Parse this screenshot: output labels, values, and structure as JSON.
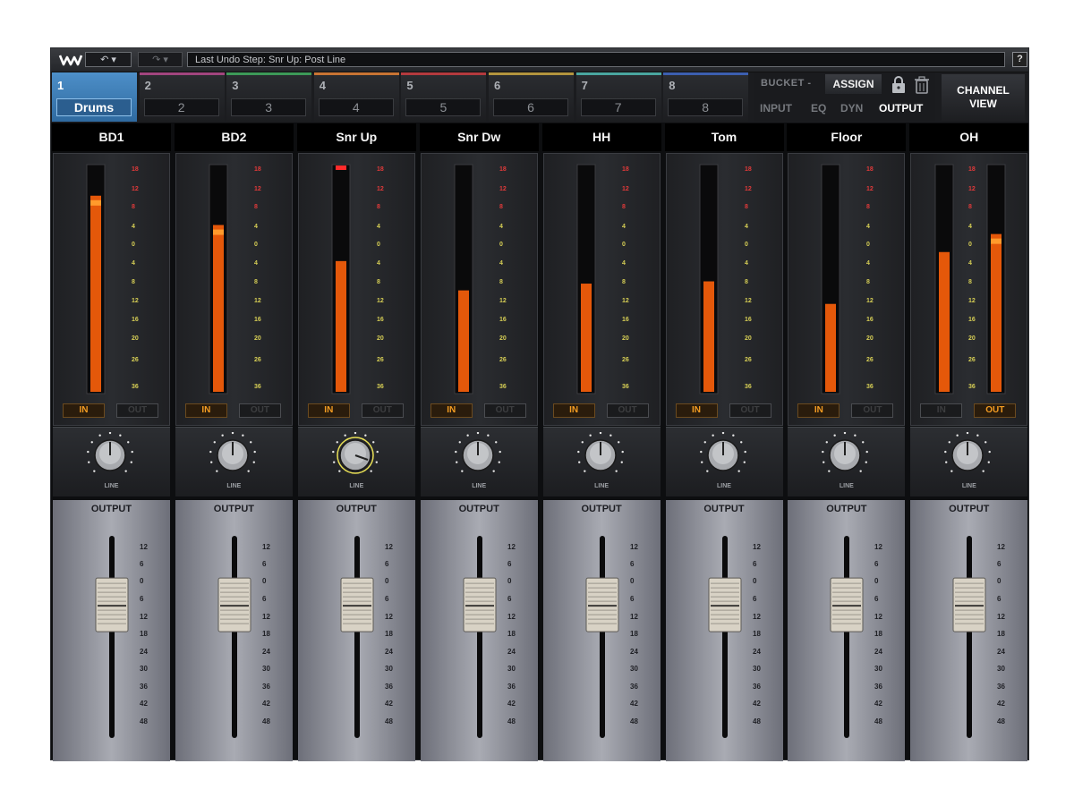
{
  "toolbar": {
    "logo": "waves-logo",
    "undo_label": "↶ ▾",
    "redo_label": "↷ ▾",
    "undo_step": "Last Undo Step:  Snr Up: Post Line",
    "help_label": "?"
  },
  "group_tabs": [
    {
      "num": "1",
      "name": "Drums",
      "color": "#4d8fc8",
      "active": true
    },
    {
      "num": "2",
      "name": "2",
      "color": "#a2457f",
      "active": false
    },
    {
      "num": "3",
      "name": "3",
      "color": "#3d9a58",
      "active": false
    },
    {
      "num": "4",
      "name": "4",
      "color": "#c87434",
      "active": false
    },
    {
      "num": "5",
      "name": "5",
      "color": "#b43a3e",
      "active": false
    },
    {
      "num": "6",
      "name": "6",
      "color": "#b3953e",
      "active": false
    },
    {
      "num": "7",
      "name": "7",
      "color": "#4aa6a0",
      "active": false
    },
    {
      "num": "8",
      "name": "8",
      "color": "#3c5fb0",
      "active": false
    }
  ],
  "bucket": {
    "label": "BUCKET -",
    "assign_label": "ASSIGN",
    "lock_icon": "lock-icon",
    "trash_icon": "trash-icon",
    "modes": [
      {
        "label": "INPUT",
        "selected": false
      },
      {
        "label": "EQ",
        "selected": false
      },
      {
        "label": "DYN",
        "selected": false
      },
      {
        "label": "OUTPUT",
        "selected": true
      }
    ]
  },
  "channel_view": {
    "line1": "CHANNEL",
    "line2": "VIEW"
  },
  "meter_scale": [
    "18",
    "12",
    "8",
    "4",
    "0",
    "4",
    "8",
    "12",
    "16",
    "20",
    "26",
    "36"
  ],
  "fader_scale": [
    "12",
    "6",
    "0",
    "6",
    "12",
    "18",
    "24",
    "30",
    "36",
    "42",
    "48"
  ],
  "knob_label": "LINE",
  "output_label": "OUTPUT",
  "in_label": "IN",
  "out_label": "OUT",
  "channels": [
    {
      "name": "BD1",
      "meter": [
        0.87
      ],
      "peak_hold": [
        0.85
      ],
      "clip": false,
      "in_on": true,
      "out_on": false,
      "knob_active": false,
      "fader": 0.35
    },
    {
      "name": "BD2",
      "meter": [
        0.74
      ],
      "peak_hold": [
        0.72
      ],
      "clip": false,
      "in_on": true,
      "out_on": false,
      "knob_active": false,
      "fader": 0.35
    },
    {
      "name": "Snr Up",
      "meter": [
        0.58
      ],
      "peak_hold": null,
      "clip": true,
      "in_on": true,
      "out_on": false,
      "knob_active": true,
      "fader": 0.35
    },
    {
      "name": "Snr Dw",
      "meter": [
        0.45
      ],
      "peak_hold": null,
      "clip": false,
      "in_on": true,
      "out_on": false,
      "knob_active": false,
      "fader": 0.35
    },
    {
      "name": "HH",
      "meter": [
        0.48
      ],
      "peak_hold": null,
      "clip": false,
      "in_on": true,
      "out_on": false,
      "knob_active": false,
      "fader": 0.35
    },
    {
      "name": "Tom",
      "meter": [
        0.49
      ],
      "peak_hold": null,
      "clip": false,
      "in_on": true,
      "out_on": false,
      "knob_active": false,
      "fader": 0.35
    },
    {
      "name": "Floor",
      "meter": [
        0.39
      ],
      "peak_hold": null,
      "clip": false,
      "in_on": true,
      "out_on": false,
      "knob_active": false,
      "fader": 0.35
    },
    {
      "name": "OH",
      "meter": [
        0.62,
        0.7
      ],
      "peak_hold": [
        null,
        0.68
      ],
      "clip": false,
      "in_on": false,
      "out_on": true,
      "knob_active": false,
      "fader": 0.35
    }
  ]
}
